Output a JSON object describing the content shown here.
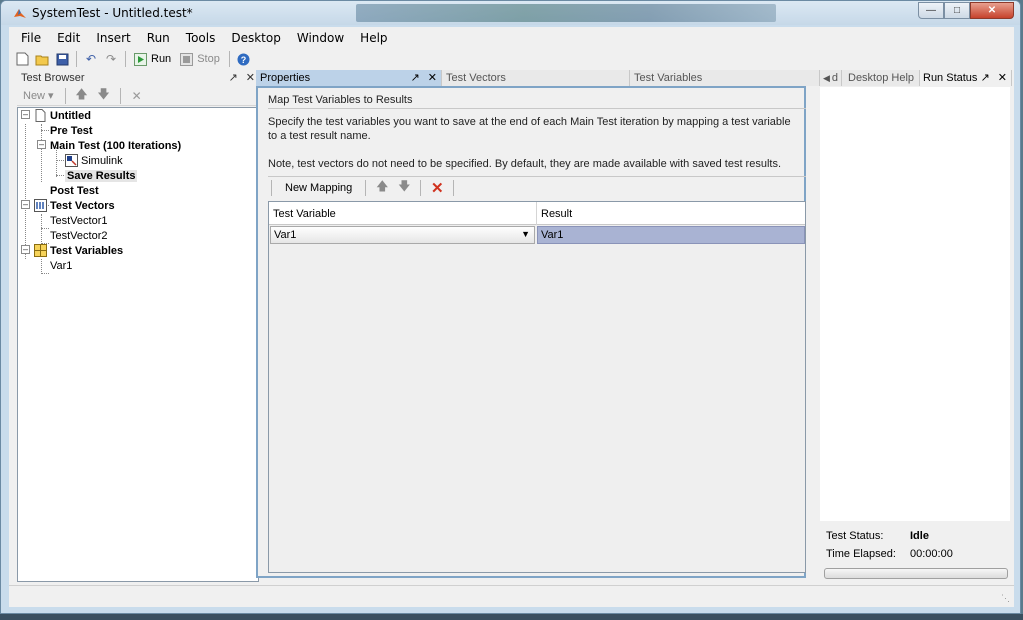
{
  "window": {
    "title": "SystemTest - Untitled.test*"
  },
  "menu": [
    "File",
    "Edit",
    "Insert",
    "Run",
    "Tools",
    "Desktop",
    "Window",
    "Help"
  ],
  "toolbar": {
    "run_label": "Run",
    "stop_label": "Stop"
  },
  "test_browser": {
    "title": "Test Browser",
    "new_label": "New ▾",
    "tree": {
      "root": "Untitled",
      "pre_test": "Pre Test",
      "main_test": "Main Test (100 Iterations)",
      "simulink": "Simulink",
      "save_results": "Save Results",
      "post_test": "Post Test",
      "test_vectors": "Test Vectors",
      "vector1": "TestVector1",
      "vector2": "TestVector2",
      "test_variables": "Test Variables",
      "var1": "Var1"
    }
  },
  "center": {
    "tabs": [
      "Properties",
      "Test Vectors",
      "Test Variables"
    ],
    "group_title": "Map Test Variables to Results",
    "desc1": "Specify the test variables you want to save at the end of each Main Test iteration by mapping a test variable to a test result name.",
    "desc2": "Note, test vectors do not need to be specified. By default, they are made available with saved test results.",
    "new_mapping_label": "New Mapping",
    "grid": {
      "columns": [
        "Test Variable",
        "Result"
      ],
      "rows": [
        {
          "variable": "Var1",
          "result": "Var1"
        }
      ]
    }
  },
  "right_panel": {
    "tabs": [
      "d",
      "Desktop Help",
      "Run Status"
    ],
    "status_label": "Test Status:",
    "status_value": "Idle",
    "elapsed_label": "Time Elapsed:",
    "elapsed_value": "00:00:00"
  },
  "colors": {
    "selection": "#a9b3d3",
    "active_tab": "#bcd2e8",
    "run_green": "#2e9a3a",
    "delete_red": "#d0321f"
  }
}
